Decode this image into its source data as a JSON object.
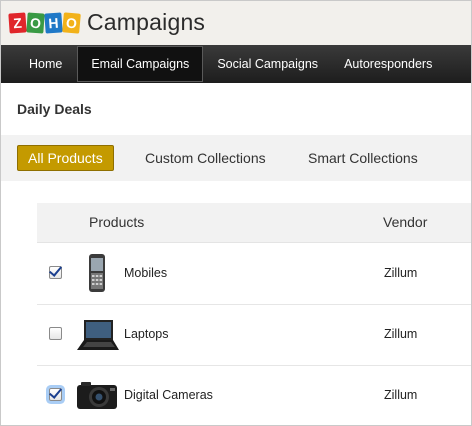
{
  "app": {
    "logo_letters": [
      "Z",
      "O",
      "H",
      "O"
    ],
    "title": "Campaigns"
  },
  "nav": [
    {
      "label": "Home",
      "active": false
    },
    {
      "label": "Email Campaigns",
      "active": true
    },
    {
      "label": "Social Campaigns",
      "active": false
    },
    {
      "label": "Autoresponders",
      "active": false
    }
  ],
  "section_title": "Daily Deals",
  "tabs": [
    {
      "label": "All Products",
      "active": true
    },
    {
      "label": "Custom Collections",
      "active": false
    },
    {
      "label": "Smart Collections",
      "active": false
    }
  ],
  "table": {
    "headers": {
      "products": "Products",
      "vendor": "Vendor"
    },
    "rows": [
      {
        "name": "Mobiles",
        "vendor": "Zillum",
        "checked": true,
        "icon": "mobile-phone-icon"
      },
      {
        "name": "Laptops",
        "vendor": "Zillum",
        "checked": false,
        "icon": "laptop-icon"
      },
      {
        "name": "Digital Cameras",
        "vendor": "Zillum",
        "checked": true,
        "icon": "camera-icon"
      }
    ]
  },
  "colors": {
    "active_tab": "#c49a00",
    "nav_bg": "#1d1d1d",
    "header_bg": "#f2f0ec"
  }
}
